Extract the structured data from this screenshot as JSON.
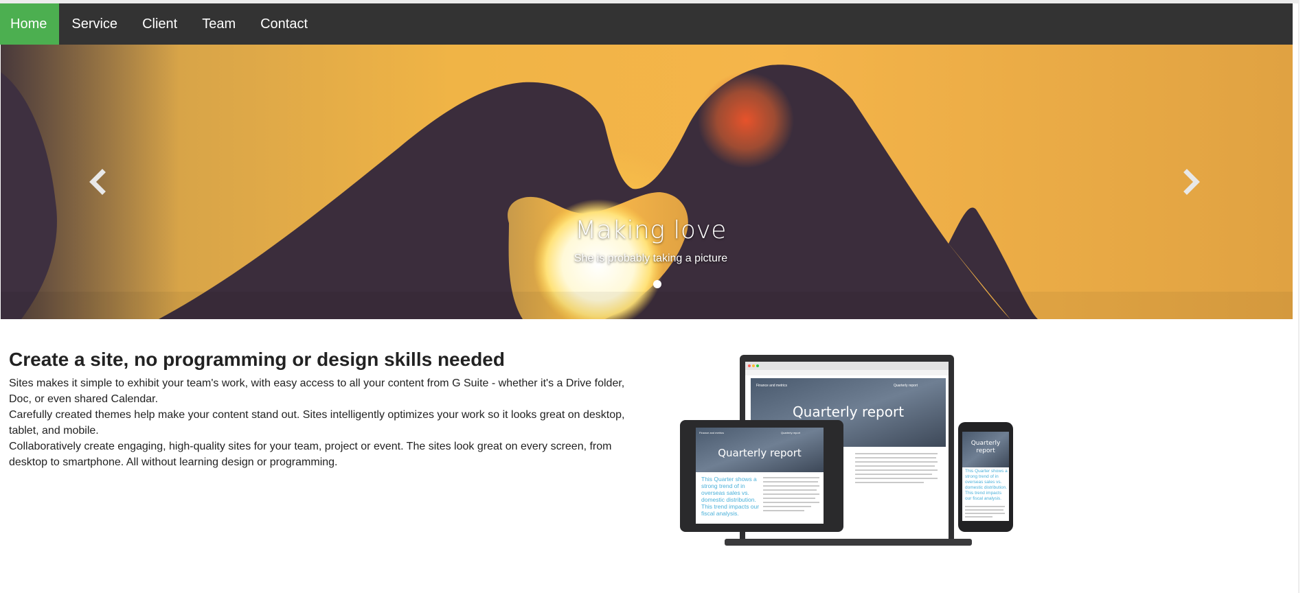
{
  "nav": {
    "items": [
      {
        "label": "Home",
        "active": true
      },
      {
        "label": "Service",
        "active": false
      },
      {
        "label": "Client",
        "active": false
      },
      {
        "label": "Team",
        "active": false
      },
      {
        "label": "Contact",
        "active": false
      }
    ],
    "active_color": "#4caf50",
    "bar_color": "#333333"
  },
  "carousel": {
    "caption_title": "Making love",
    "caption_subtitle": "She is probably taking a picture",
    "prev_icon": "chevron-left-icon",
    "next_icon": "chevron-right-icon",
    "slide_count": 1,
    "active_slide": 1
  },
  "main": {
    "headline": "Create a site, no programming or design skills needed",
    "paragraphs": [
      "Sites makes it simple to exhibit your team's work, with easy access to all your content from G Suite - whether it's a Drive folder, Doc, or even shared Calendar.",
      "Carefully created themes help make your content stand out. Sites intelligently optimizes your work so it looks great on desktop, tablet, and mobile.",
      "Collaboratively create engaging, high-quality sites for your team, project or event. The sites look great on every screen, from desktop to smartphone. All without learning design or programming."
    ]
  },
  "devices_image": {
    "laptop_title": "Quarterly report",
    "laptop_nav_left": "Finance and metrics",
    "laptop_nav_right": "Quarterly report",
    "tablet_title": "Quarterly report",
    "tablet_nav_left": "Finance and metrics",
    "tablet_nav_right": "Quarterly report",
    "tablet_quote": "This Quarter shows a strong trend of in overseas sales vs. domestic distribution. This trend impacts our fiscal analysis.",
    "phone_title": "Quarterly report",
    "phone_quote": "This Quarter shows a strong trend of in overseas sales vs. domestic distribution. This trend impacts our fiscal analysis.",
    "accent_color": "#4ab0d9"
  }
}
